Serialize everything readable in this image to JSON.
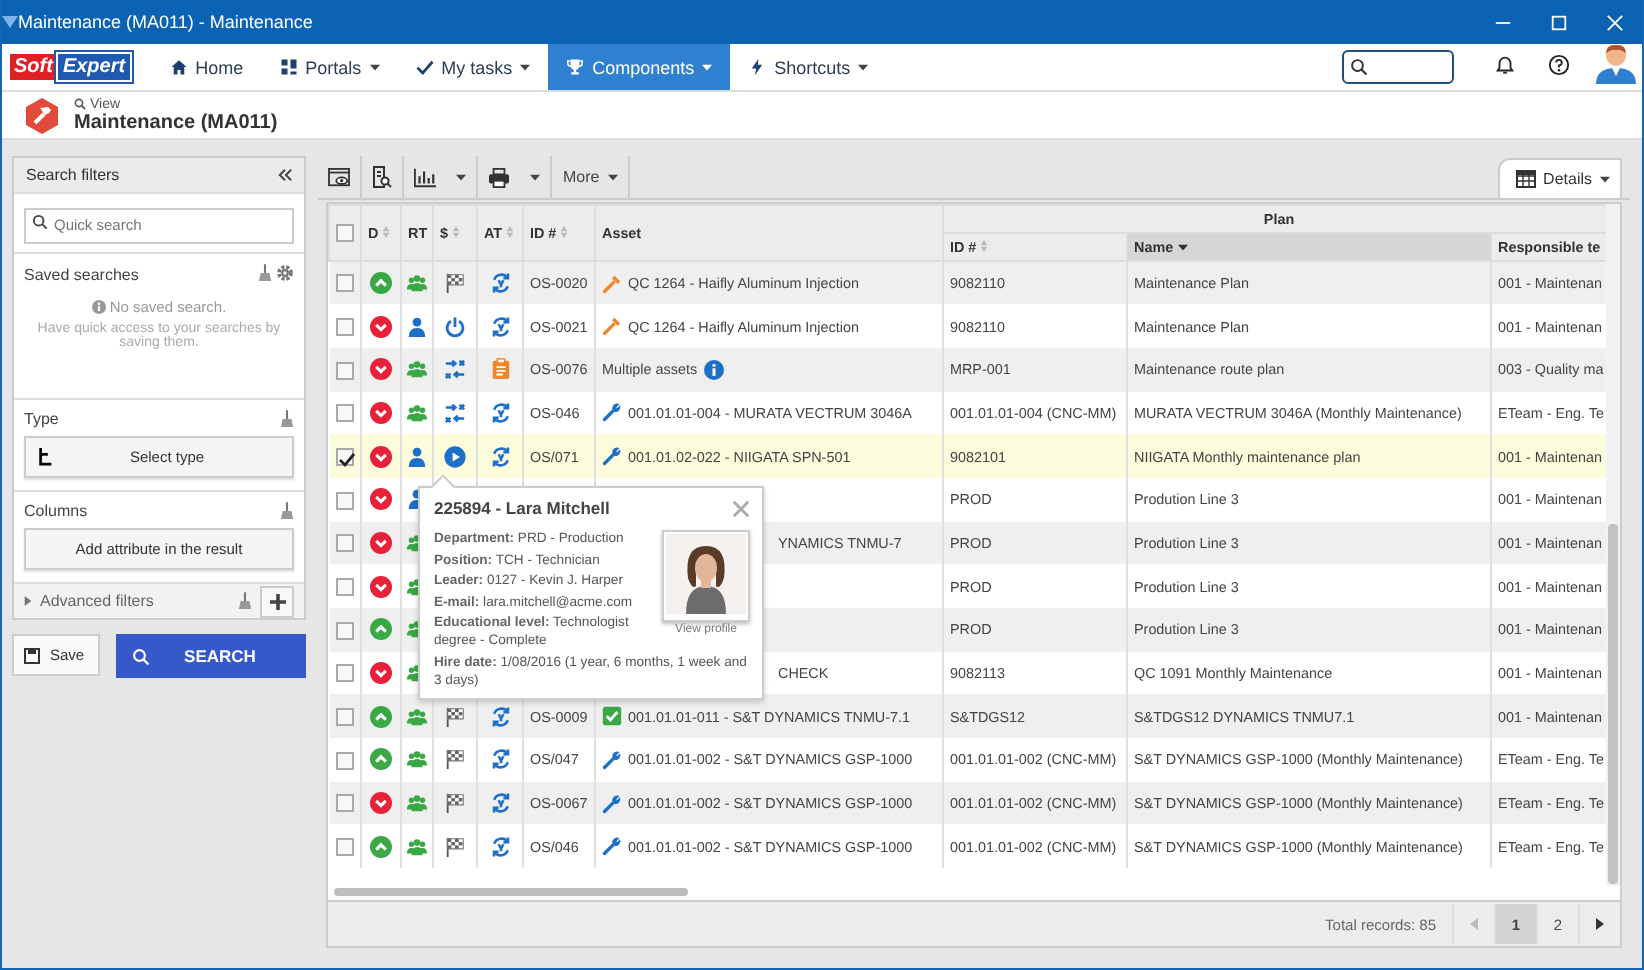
{
  "window": {
    "title": "Maintenance (MA011) - Maintenance"
  },
  "nav": {
    "logo": [
      "Soft",
      "Expert"
    ],
    "items": [
      {
        "label": "Home",
        "dropdown": false,
        "selected": false
      },
      {
        "label": "Portals",
        "dropdown": true,
        "selected": false
      },
      {
        "label": "My tasks",
        "dropdown": true,
        "selected": false
      },
      {
        "label": "Components",
        "dropdown": true,
        "selected": true
      },
      {
        "label": "Shortcuts",
        "dropdown": true,
        "selected": false
      }
    ]
  },
  "page_header": {
    "breadcrumb": "View",
    "title": "Maintenance (MA011)"
  },
  "search_filters": {
    "title": "Search filters",
    "quick_search": {
      "placeholder": "Quick search"
    },
    "saved_searches": {
      "title": "Saved searches",
      "empty": "No saved search.",
      "hint": "Have quick access to your searches by saving them."
    },
    "type": {
      "title": "Type",
      "button": "Select type"
    },
    "columns": {
      "title": "Columns",
      "button": "Add attribute in the result"
    },
    "advanced_filters": "Advanced filters",
    "save": "Save",
    "search": "SEARCH"
  },
  "toolbar": {
    "more": "More",
    "details": "Details"
  },
  "table": {
    "all_checked": false,
    "columns": [
      {
        "label": "D",
        "kind": "sortable"
      },
      {
        "label": "RT",
        "kind": "plain"
      },
      {
        "label": "$",
        "kind": "sortable"
      },
      {
        "label": "AT",
        "kind": "sortable"
      },
      {
        "label": "ID #",
        "kind": "sortable"
      },
      {
        "label": "Asset",
        "kind": "plain"
      }
    ],
    "plan_group": "Plan",
    "plan_columns": [
      {
        "label": "ID #",
        "kind": "sortable"
      },
      {
        "label": "Name",
        "kind": "sorted-desc"
      },
      {
        "label": "Responsible te",
        "kind": "plain"
      }
    ],
    "rows": [
      {
        "checked": false,
        "selected": false,
        "icons": [
          {
            "kind": "up"
          },
          {
            "kind": "group"
          },
          {
            "kind": "flag"
          },
          {
            "kind": "cycle"
          }
        ],
        "id": "OS-0020",
        "asset": {
          "kind": "tool",
          "text": "QC 1264 - Haifly Aluminum Injection"
        },
        "plan_id": "9082110",
        "plan_name": "Maintenance Plan",
        "responsible": "001 - Maintenan"
      },
      {
        "checked": false,
        "selected": false,
        "icons": [
          {
            "kind": "down"
          },
          {
            "kind": "person"
          },
          {
            "kind": "power"
          },
          {
            "kind": "cycle"
          }
        ],
        "id": "OS-0021",
        "asset": {
          "kind": "tool",
          "text": "QC 1264 - Haifly Aluminum Injection"
        },
        "plan_id": "9082110",
        "plan_name": "Maintenance Plan",
        "responsible": "001 - Maintenan"
      },
      {
        "checked": false,
        "selected": false,
        "icons": [
          {
            "kind": "down"
          },
          {
            "kind": "group"
          },
          {
            "kind": "shuffle"
          },
          {
            "kind": "clipboard"
          }
        ],
        "id": "OS-0076",
        "asset": {
          "kind": "multiple",
          "text": "Multiple assets"
        },
        "plan_id": "MRP-001",
        "plan_name": "Maintenance route plan",
        "responsible": "003 - Quality ma"
      },
      {
        "checked": false,
        "selected": false,
        "icons": [
          {
            "kind": "down"
          },
          {
            "kind": "group"
          },
          {
            "kind": "shuffle"
          },
          {
            "kind": "cycle"
          }
        ],
        "id": "OS-046",
        "asset": {
          "kind": "wrench",
          "text": "001.01.01-004 - MURATA VECTRUM 3046A"
        },
        "plan_id": "001.01.01-004 (CNC-MM)",
        "plan_name": "MURATA VECTRUM 3046A (Monthly Maintenance)",
        "responsible": "ETeam - Eng. Te"
      },
      {
        "checked": true,
        "selected": true,
        "icons": [
          {
            "kind": "down"
          },
          {
            "kind": "person"
          },
          {
            "kind": "play"
          },
          {
            "kind": "cycle"
          }
        ],
        "id": "OS/071",
        "asset": {
          "kind": "wrench",
          "text": "001.01.02-022 - NIIGATA SPN-501"
        },
        "plan_id": "9082101",
        "plan_name": "NIIGATA Monthly maintenance plan",
        "responsible": "001 - Maintenan"
      },
      {
        "checked": false,
        "selected": false,
        "icons": [
          {
            "kind": "down"
          },
          {
            "kind": "person"
          }
        ],
        "plan_id": "PROD",
        "plan_name": "Prodution Line 3",
        "responsible": "001 - Maintenan"
      },
      {
        "checked": false,
        "selected": false,
        "icons": [
          {
            "kind": "down"
          },
          {
            "kind": "group"
          }
        ],
        "asset": {
          "kind": "clipped",
          "text": "YNAMICS TNMU-7"
        },
        "plan_id": "PROD",
        "plan_name": "Prodution Line 3",
        "responsible": "001 - Maintenan"
      },
      {
        "checked": false,
        "selected": false,
        "icons": [
          {
            "kind": "down"
          },
          {
            "kind": "group"
          }
        ],
        "plan_id": "PROD",
        "plan_name": "Prodution Line 3",
        "responsible": "001 - Maintenan"
      },
      {
        "checked": false,
        "selected": false,
        "icons": [
          {
            "kind": "up"
          },
          {
            "kind": "group"
          }
        ],
        "plan_id": "PROD",
        "plan_name": "Prodution Line 3",
        "responsible": "001 - Maintenan"
      },
      {
        "checked": false,
        "selected": false,
        "icons": [
          {
            "kind": "down"
          },
          {
            "kind": "group"
          }
        ],
        "asset": {
          "kind": "clipped",
          "text": "CHECK"
        },
        "plan_id": "9082113",
        "plan_name": "QC 1091 Monthly Maintenance",
        "responsible": "001 - Maintenan"
      },
      {
        "checked": false,
        "selected": false,
        "icons": [
          {
            "kind": "up"
          },
          {
            "kind": "group"
          },
          {
            "kind": "flag"
          },
          {
            "kind": "cycle"
          }
        ],
        "id": "OS-0009",
        "asset": {
          "kind": "check",
          "text": "001.01.01-011 - S&T DYNAMICS TNMU-7.1"
        },
        "plan_id": "S&TDGS12",
        "plan_name": "S&TDGS12 DYNAMICS TNMU7.1",
        "responsible": "001 - Maintenan"
      },
      {
        "checked": false,
        "selected": false,
        "icons": [
          {
            "kind": "up"
          },
          {
            "kind": "group"
          },
          {
            "kind": "flag"
          },
          {
            "kind": "cycle"
          }
        ],
        "id": "OS/047",
        "asset": {
          "kind": "wrench",
          "text": "001.01.01-002 - S&T DYNAMICS GSP-1000"
        },
        "plan_id": "001.01.01-002 (CNC-MM)",
        "plan_name": "S&T DYNAMICS GSP-1000 (Monthly Maintenance)",
        "responsible": "ETeam - Eng. Te"
      },
      {
        "checked": false,
        "selected": false,
        "icons": [
          {
            "kind": "down"
          },
          {
            "kind": "group"
          },
          {
            "kind": "flag"
          },
          {
            "kind": "cycle"
          }
        ],
        "id": "OS-0067",
        "asset": {
          "kind": "wrench",
          "text": "001.01.01-002 - S&T DYNAMICS GSP-1000"
        },
        "plan_id": "001.01.01-002 (CNC-MM)",
        "plan_name": "S&T DYNAMICS GSP-1000 (Monthly Maintenance)",
        "responsible": "ETeam - Eng. Te"
      },
      {
        "checked": false,
        "selected": false,
        "icons": [
          {
            "kind": "up"
          },
          {
            "kind": "group"
          },
          {
            "kind": "flag"
          },
          {
            "kind": "cycle"
          }
        ],
        "id": "OS/046",
        "asset": {
          "kind": "wrench",
          "text": "001.01.01-002 - S&T DYNAMICS GSP-1000"
        },
        "plan_id": "001.01.01-002 (CNC-MM)",
        "plan_name": "S&T DYNAMICS GSP-1000 (Monthly Maintenance)",
        "responsible": "ETeam - Eng. Te"
      }
    ]
  },
  "profile_popup": {
    "title": "225894 - Lara Mitchell",
    "fields": [
      {
        "kind": "narrow",
        "text": "**Department:** PRD - Production"
      },
      {
        "kind": "narrow",
        "text": "**Position:** TCH - Technician"
      },
      {
        "kind": "narrow",
        "text": "**Leader:** 0127 - Kevin J. Harper"
      },
      {
        "kind": "narrow",
        "text": "**E-mail:** lara.mitchell@acme.com"
      },
      {
        "kind": "narrow",
        "text": "**Educational level:** Technologist degree - Complete"
      },
      {
        "kind": "wide",
        "text": "**Hire date:** 1/08/2016 (1 year, 6 months, 1 week and 3 days)"
      }
    ],
    "link": "View profile"
  },
  "pager": {
    "total": "Total records: 85",
    "pages": [
      {
        "label": "1",
        "selected": true
      },
      {
        "label": "2",
        "selected": false
      }
    ]
  }
}
